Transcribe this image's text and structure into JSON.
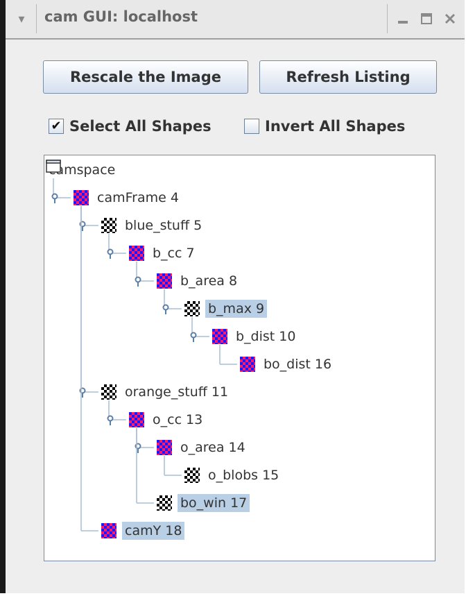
{
  "window": {
    "title": "cam GUI: localhost",
    "menu_icon": "chevron-down-icon",
    "controls": [
      "minimize-icon",
      "maximize-icon",
      "close-icon"
    ]
  },
  "buttons": {
    "rescale": "Rescale the Image",
    "refresh": "Refresh Listing"
  },
  "checkboxes": {
    "select_all": {
      "label": "Select All Shapes",
      "checked": true
    },
    "invert_all": {
      "label": "Invert All Shapes",
      "checked": false
    }
  },
  "tree": {
    "root": "camspace",
    "nodes": [
      {
        "label": "camFrame 4",
        "icon": "shape",
        "depth": 1,
        "selected": false
      },
      {
        "label": "blue_stuff 5",
        "icon": "checker",
        "depth": 2,
        "selected": false
      },
      {
        "label": "b_cc 7",
        "icon": "shape",
        "depth": 3,
        "selected": false
      },
      {
        "label": "b_area 8",
        "icon": "shape",
        "depth": 4,
        "selected": false
      },
      {
        "label": "b_max 9",
        "icon": "checker",
        "depth": 5,
        "selected": true
      },
      {
        "label": "b_dist 10",
        "icon": "shape",
        "depth": 6,
        "selected": false
      },
      {
        "label": "bo_dist 16",
        "icon": "shape",
        "depth": 7,
        "selected": false
      },
      {
        "label": "orange_stuff 11",
        "icon": "checker",
        "depth": 2,
        "selected": false
      },
      {
        "label": "o_cc 13",
        "icon": "shape",
        "depth": 3,
        "selected": false
      },
      {
        "label": "o_area 14",
        "icon": "shape",
        "depth": 4,
        "selected": false
      },
      {
        "label": "o_blobs 15",
        "icon": "checker",
        "depth": 5,
        "selected": false
      },
      {
        "label": "bo_win 17",
        "icon": "checker",
        "depth": 4,
        "selected": true
      },
      {
        "label": "camY 18",
        "icon": "shape",
        "depth": 2,
        "selected": true
      }
    ]
  }
}
